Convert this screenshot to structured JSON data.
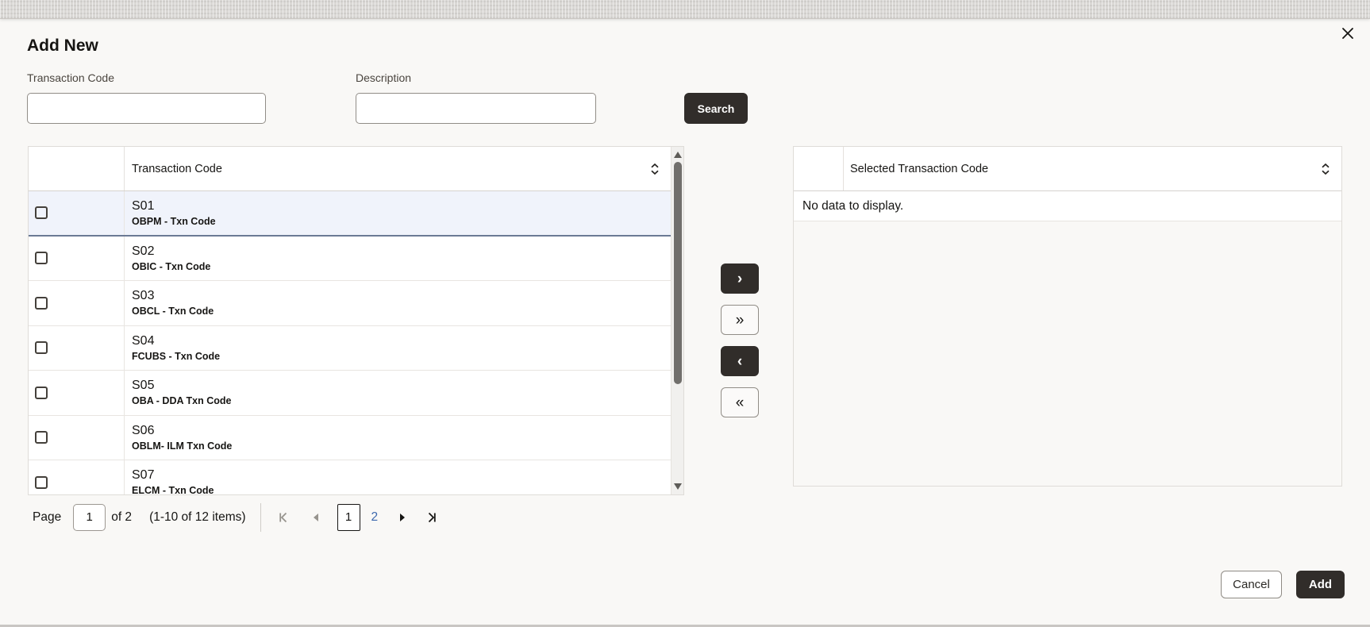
{
  "dialog": {
    "title": "Add New"
  },
  "search_form": {
    "transaction_code_label": "Transaction Code",
    "transaction_code_value": "",
    "description_label": "Description",
    "description_value": "",
    "search_button": "Search"
  },
  "left_table": {
    "header": "Transaction Code",
    "rows": [
      {
        "code": "S01",
        "description": "OBPM - Txn Code",
        "highlighted": true
      },
      {
        "code": "S02",
        "description": "OBIC - Txn Code",
        "highlighted": false
      },
      {
        "code": "S03",
        "description": "OBCL - Txn Code",
        "highlighted": false
      },
      {
        "code": "S04",
        "description": "FCUBS - Txn Code",
        "highlighted": false
      },
      {
        "code": "S05",
        "description": "OBA - DDA Txn Code",
        "highlighted": false
      },
      {
        "code": "S06",
        "description": "OBLM- ILM Txn Code",
        "highlighted": false
      },
      {
        "code": "S07",
        "description": "ELCM - Txn Code",
        "highlighted": false
      }
    ]
  },
  "right_table": {
    "header": "Selected Transaction Code",
    "empty_message": "No data to display."
  },
  "transfer": {
    "move_right_glyph": "›",
    "move_all_right_glyph": "»",
    "move_left_glyph": "‹",
    "move_all_left_glyph": "«"
  },
  "pagination": {
    "page_label": "Page",
    "page_input_value": "1",
    "of_label": "of 2",
    "items_label": "(1-10 of 12 items)",
    "current_page": "1",
    "next_page_link": "2"
  },
  "footer": {
    "cancel_button": "Cancel",
    "add_button": "Add"
  },
  "colors": {
    "accent_dark": "#312d2a",
    "modal_background": "#f9f8f6",
    "row_highlight": "#f0f3fb",
    "row_highlight_border": "#6b7a94",
    "link_blue": "#3e69ae",
    "disabled_icon": "#97948e"
  }
}
